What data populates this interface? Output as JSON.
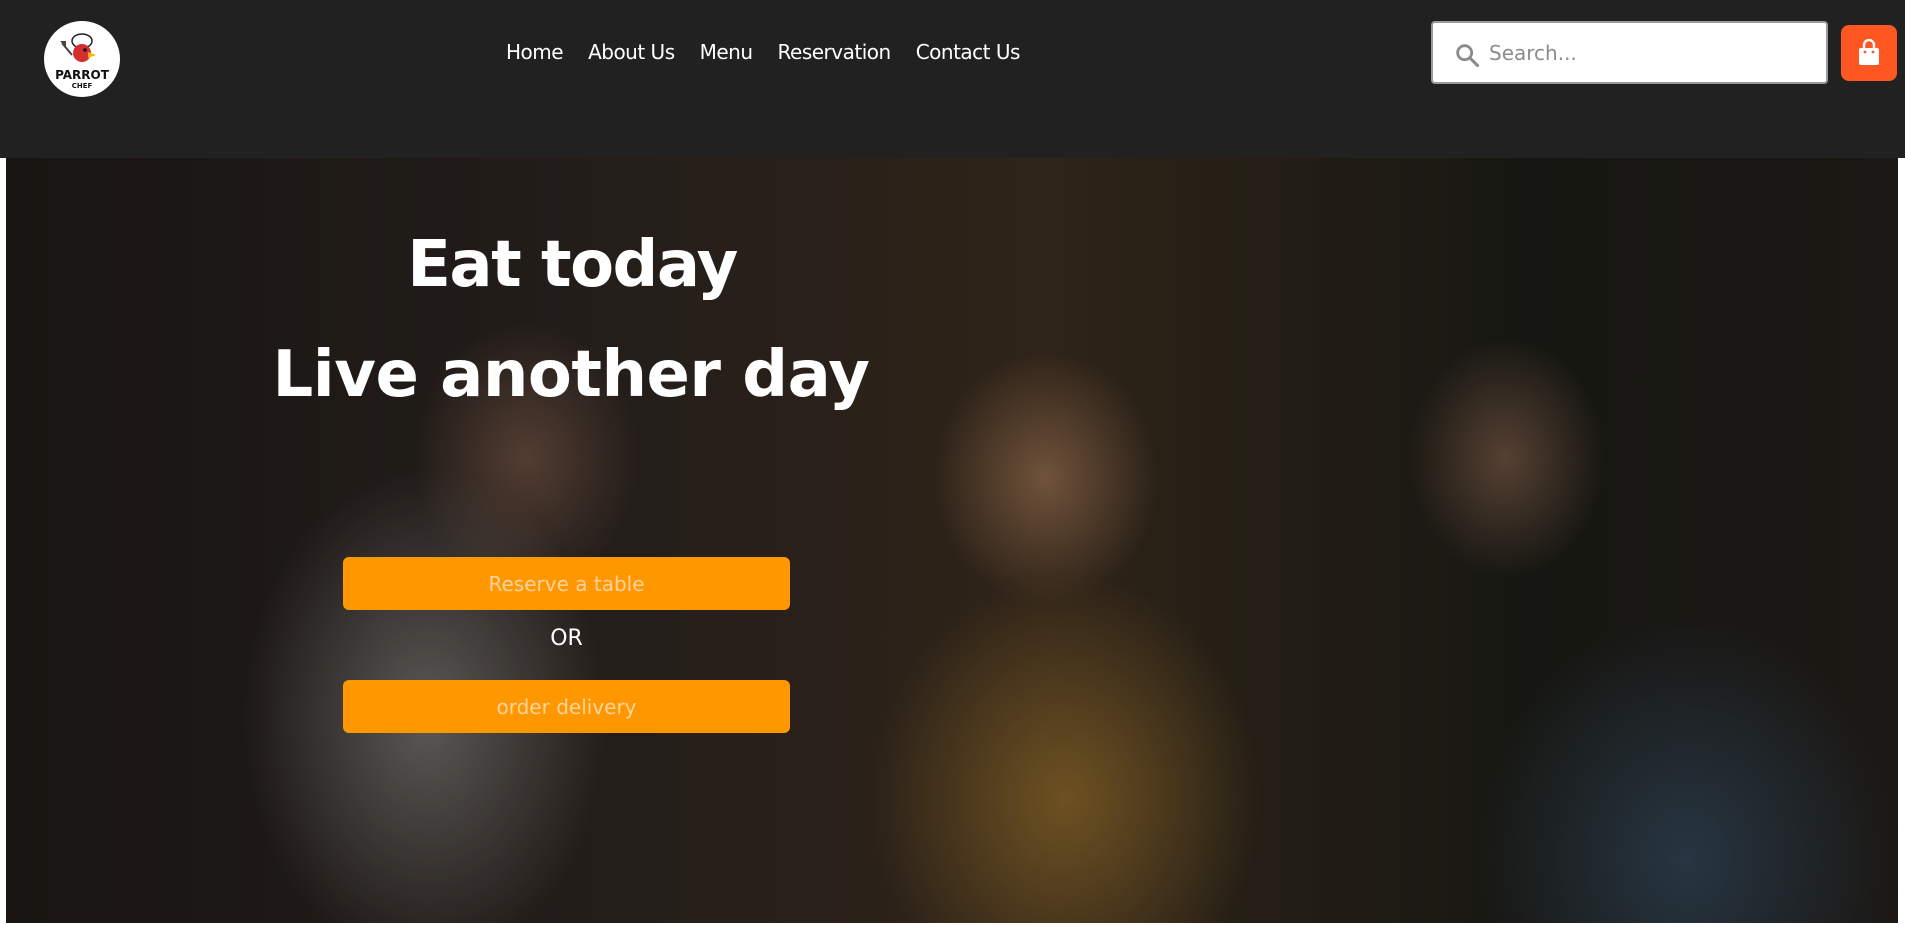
{
  "header": {
    "logo": {
      "text": "PARROT",
      "subtext": "CHEF"
    },
    "nav": [
      {
        "label": "Home"
      },
      {
        "label": "About Us"
      },
      {
        "label": "Menu"
      },
      {
        "label": "Reservation"
      },
      {
        "label": "Contact Us"
      }
    ],
    "search": {
      "placeholder": "Search...",
      "value": "",
      "icon": "search-icon"
    },
    "cart": {
      "icon": "shopping-bag-icon",
      "color": "#ff5722"
    }
  },
  "hero": {
    "headline": "Eat today",
    "subheadline": "Live another day",
    "reserve_label": "Reserve a table",
    "or_label": "OR",
    "delivery_label": "order delivery",
    "button_color": "#ff9800"
  }
}
